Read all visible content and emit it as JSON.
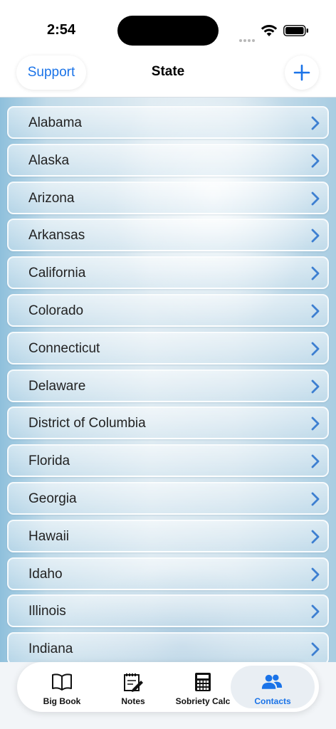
{
  "status_bar": {
    "time": "2:54"
  },
  "nav": {
    "support_label": "Support",
    "title": "State",
    "add_icon": "plus-icon"
  },
  "states": [
    {
      "label": "Alabama"
    },
    {
      "label": "Alaska"
    },
    {
      "label": "Arizona"
    },
    {
      "label": "Arkansas"
    },
    {
      "label": "California"
    },
    {
      "label": "Colorado"
    },
    {
      "label": "Connecticut"
    },
    {
      "label": "Delaware"
    },
    {
      "label": "District of Columbia"
    },
    {
      "label": "Florida"
    },
    {
      "label": "Georgia"
    },
    {
      "label": "Hawaii"
    },
    {
      "label": "Idaho"
    },
    {
      "label": "Illinois"
    },
    {
      "label": "Indiana"
    }
  ],
  "tabs": [
    {
      "label": "Big Book",
      "icon": "book-icon",
      "active": false
    },
    {
      "label": "Notes",
      "icon": "notepad-icon",
      "active": false
    },
    {
      "label": "Sobriety Calc",
      "icon": "calculator-icon",
      "active": false
    },
    {
      "label": "Contacts",
      "icon": "contacts-icon",
      "active": true
    }
  ],
  "colors": {
    "accent": "#1a73e8",
    "chevron": "#3d7fd1"
  }
}
